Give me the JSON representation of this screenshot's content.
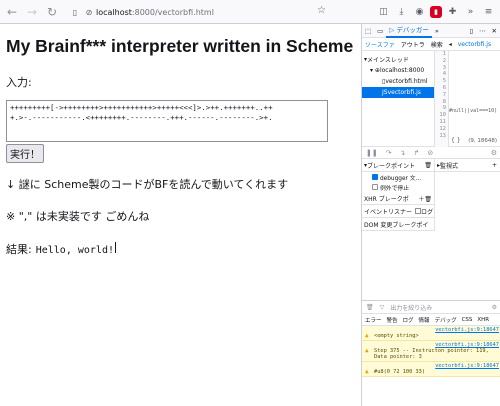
{
  "browser": {
    "url_host": "localhost",
    "url_path": ":8000/vectorbfi.html"
  },
  "page": {
    "title": "My Brainf*** interpreter written in Scheme",
    "input_label": "入力:",
    "code": "+++++++++[->++++++++>+++++++++++>+++++<<<]>.>++.+++++++..++\n+.>-.-----------.<++++++++.--------.+++.------.--------.>+.",
    "run_button": "実行！",
    "note1": "↓ 謎に Scheme製のコードがBFを読んで動いてくれます",
    "note2": "※ \",\" は未実装です ごめんね",
    "result_label": "結果:",
    "result_value": "Hello, world!"
  },
  "devtools": {
    "tab_debugger": "デバッガー",
    "sub_tabs": [
      "ソースファ",
      "アウトラ",
      "検索"
    ],
    "file_tab": "vectorbfi.js",
    "tree": [
      "メインスレッド",
      "localhost:8000",
      "vectorbfi.html",
      "vectorbfi.js"
    ],
    "gutter": [
      "1",
      "2",
      "3",
      "4",
      "5",
      "6",
      "7",
      "8",
      "9",
      "10",
      "11",
      "12",
      "13"
    ],
    "snippet": "#null||val===10)",
    "cursor_pos": "(9, 18648)",
    "curly": "{ }",
    "breakpoints_header": "ブレークポイント",
    "watch_header": "監視式",
    "bp_items": [
      "debugger 文...",
      "例外で停止"
    ],
    "xhr": "XHR ブレークポ",
    "event": "イベントリスナー",
    "log": "ログ",
    "dom": "DOM 変更ブレークポイ",
    "console_filter": "出力を絞り込み",
    "console_filters": [
      "エラー",
      "警告",
      "ログ",
      "情報",
      "デバッグ",
      "CSS",
      "XHR"
    ],
    "messages": [
      {
        "text": "<empty string>",
        "link": "vectorbfi.js:9:18647"
      },
      {
        "text": "Step 375 -- Instructon pointer: 119, Data pointer: 3",
        "link": "vectorbfi.js:9:18647"
      },
      {
        "text": "#u8(0 72 100 33)",
        "link": "vectorbfi.js:9:18647"
      }
    ]
  }
}
